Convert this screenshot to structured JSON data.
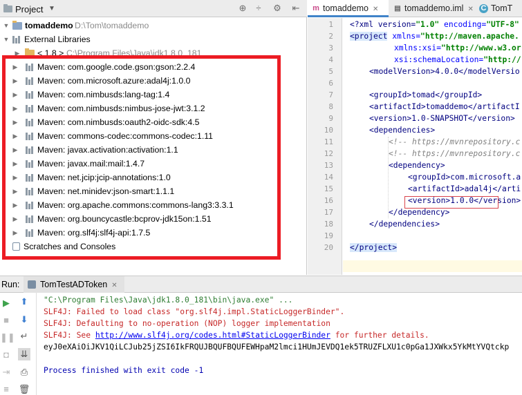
{
  "project": {
    "title": "Project",
    "root": {
      "name": "tomaddemo",
      "path": "D:\\Tom\\tomaddemo"
    },
    "external_libraries": "External Libraries",
    "jdk": {
      "name": "< 1.8 >",
      "path": "C:\\Program Files\\Java\\jdk1.8.0_181"
    },
    "libraries": [
      "Maven: com.google.code.gson:gson:2.2.4",
      "Maven: com.microsoft.azure:adal4j:1.0.0",
      "Maven: com.nimbusds:lang-tag:1.4",
      "Maven: com.nimbusds:nimbus-jose-jwt:3.1.2",
      "Maven: com.nimbusds:oauth2-oidc-sdk:4.5",
      "Maven: commons-codec:commons-codec:1.11",
      "Maven: javax.activation:activation:1.1",
      "Maven: javax.mail:mail:1.4.7",
      "Maven: net.jcip:jcip-annotations:1.0",
      "Maven: net.minidev:json-smart:1.1.1",
      "Maven: org.apache.commons:commons-lang3:3.3.1",
      "Maven: org.bouncycastle:bcprov-jdk15on:1.51",
      "Maven: org.slf4j:slf4j-api:1.7.5"
    ],
    "scratches": "Scratches and Consoles"
  },
  "editor": {
    "tabs": [
      {
        "label": "tomaddemo",
        "icon": "maven-icon",
        "active": true
      },
      {
        "label": "tomaddemo.iml",
        "icon": "iml-file-icon",
        "active": false
      },
      {
        "label": "TomT",
        "icon": "class-icon",
        "active": false
      }
    ],
    "line_numbers": [
      "1",
      "2",
      "3",
      "4",
      "5",
      "6",
      "7",
      "8",
      "9",
      "10",
      "11",
      "12",
      "13",
      "14",
      "15",
      "16",
      "17",
      "18",
      "19",
      "20"
    ],
    "code": {
      "l1_a": "<?xml version=",
      "l1_b": "\"1.0\"",
      "l1_c": " encoding=",
      "l1_d": "\"UTF-8\"",
      "l2_a": "<project",
      "l2_b": " xmlns=",
      "l2_c": "\"http://maven.apache.",
      "l3_a": "xmlns:xsi=",
      "l3_b": "\"http://www.w3.or",
      "l4_a": "xsi:schemaLocation=",
      "l4_b": "\"http://",
      "l5": "<modelVersion>4.0.0</modelVersio",
      "l7": "<groupId>tomad</groupId>",
      "l8": "<artifactId>tomaddemo</artifactI",
      "l9": "<version>1.0-SNAPSHOT</version>",
      "l10": "<dependencies>",
      "l11": "<!-- https://mvnrepository.c",
      "l12": "<!-- https://mvnrepository.c",
      "l13": "<dependency>",
      "l14": "<groupId>com.microsoft.a",
      "l15": "<artifactId>adal4j</arti",
      "l16": "<version>1.0.0</version>",
      "l17": "</dependency>",
      "l18": "</dependencies>",
      "l20": "</project>"
    }
  },
  "run": {
    "label": "Run:",
    "tab": "TomTestADToken",
    "console": {
      "cmd": "\"C:\\Program Files\\Java\\jdk1.8.0_181\\bin\\java.exe\" ...",
      "err1": "SLF4J: Failed to load class \"org.slf4j.impl.StaticLoggerBinder\".",
      "err2": "SLF4J: Defaulting to no-operation (NOP) logger implementation",
      "err3_a": "SLF4J: See ",
      "err3_link": "http://www.slf4j.org/codes.html#StaticLoggerBinder",
      "err3_b": " for further details.",
      "token": "eyJ0eXAiOiJKV1QiLCJub25jZSI6IkFRQUJBQUFBQUFEWHpaM2lmci1HUmJEVDQ1ek5TRUZFLXU1c0pGa1JXWkx5YkMtYVQtckp",
      "exit": "Process finished with exit code -1"
    }
  }
}
